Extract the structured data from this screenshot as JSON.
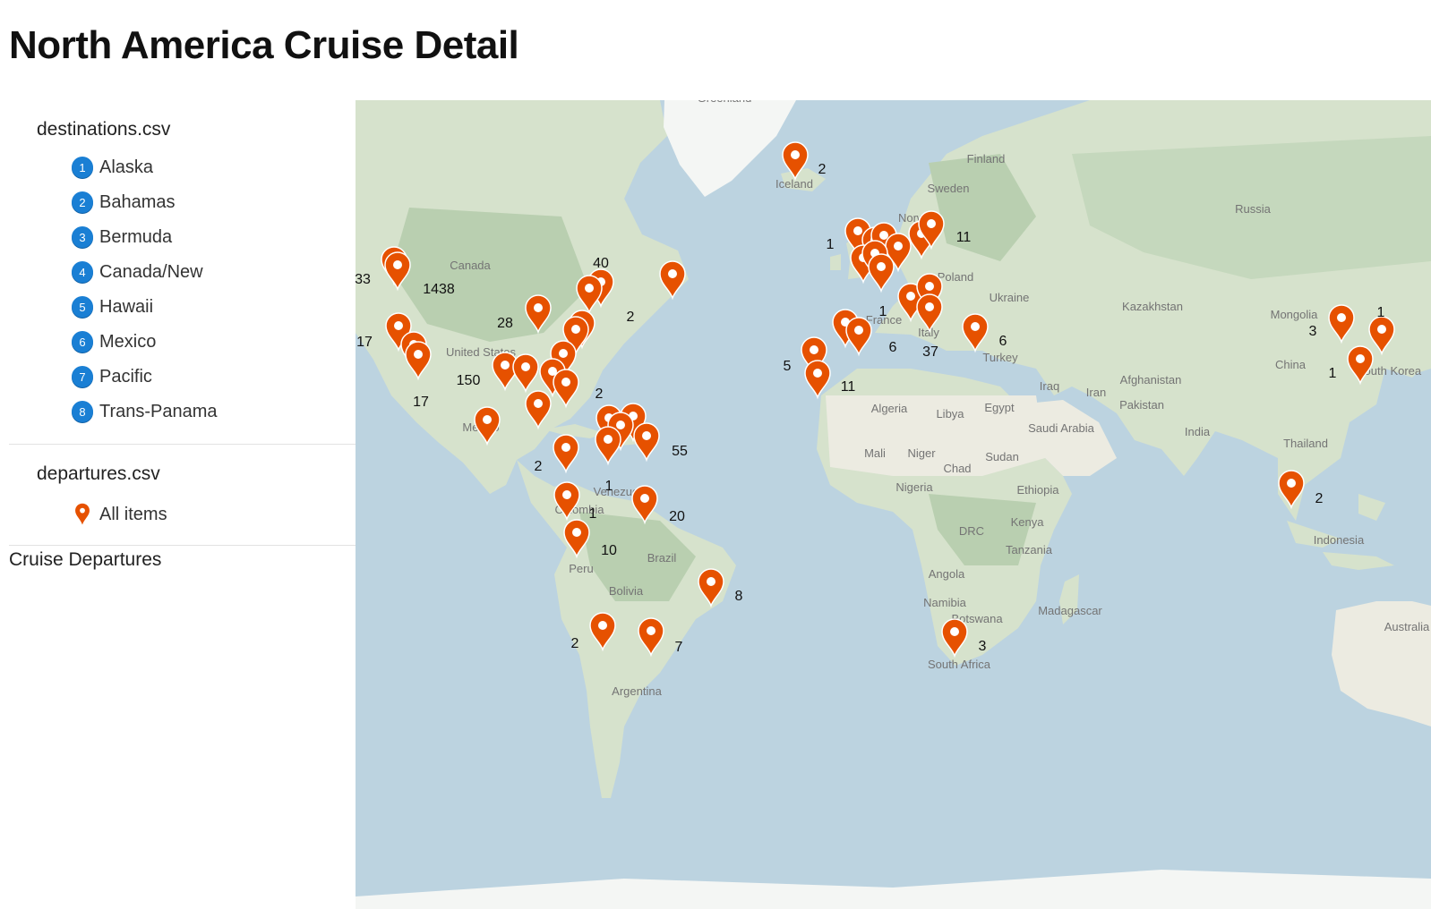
{
  "page": {
    "title": "North America Cruise Detail"
  },
  "sidebar": {
    "destinations": {
      "title": "destinations.csv",
      "items": [
        {
          "num": "1",
          "label": "Alaska"
        },
        {
          "num": "2",
          "label": "Bahamas"
        },
        {
          "num": "3",
          "label": "Bermuda"
        },
        {
          "num": "4",
          "label": "Canada/New"
        },
        {
          "num": "5",
          "label": "Hawaii"
        },
        {
          "num": "6",
          "label": "Mexico"
        },
        {
          "num": "7",
          "label": "Pacific"
        },
        {
          "num": "8",
          "label": "Trans-Panama"
        }
      ]
    },
    "departures": {
      "title": "departures.csv",
      "items": [
        {
          "icon": "map-pin-icon",
          "label": "All items"
        }
      ]
    },
    "footer_label": "Cruise Departures"
  },
  "colors": {
    "accent_blue": "#1a7fd4",
    "marker": "#e65100",
    "water": "#bcd3e0",
    "land": "#d6e2cc",
    "forest": "#b9cfb0",
    "desert": "#ecebe1",
    "ice": "#f4f6f4"
  },
  "map": {
    "place_labels": [
      "Greenland",
      "Iceland",
      "Finland",
      "Sweden",
      "Norway",
      "Russia",
      "Canada",
      "Poland",
      "Ukraine",
      "Kazakhstan",
      "Mongolia",
      "France",
      "Italy",
      "Turkey",
      "China",
      "United States",
      "Mexico",
      "Algeria",
      "Libya",
      "Egypt",
      "Iraq",
      "Iran",
      "Afghanistan",
      "Pakistan",
      "India",
      "Saudi Arabia",
      "Thailand",
      "Mali",
      "Niger",
      "Chad",
      "Sudan",
      "Nigeria",
      "Ethiopia",
      "Venezuela",
      "Colombia",
      "Kenya",
      "DRC",
      "Tanzania",
      "Brazil",
      "Peru",
      "Bolivia",
      "Angola",
      "Namibia",
      "Botswana",
      "Madagascar",
      "South Africa",
      "Argentina",
      "Indonesia",
      "South Korea",
      "Australia"
    ],
    "cluster_counts": [
      "2",
      "1",
      "11",
      "33",
      "1438",
      "40",
      "2",
      "28",
      "1",
      "6",
      "37",
      "6",
      "3",
      "1",
      "17",
      "150",
      "5",
      "11",
      "17",
      "2",
      "1",
      "55",
      "2",
      "1",
      "1",
      "20",
      "10",
      "2",
      "8",
      "2",
      "7",
      "3"
    ]
  }
}
